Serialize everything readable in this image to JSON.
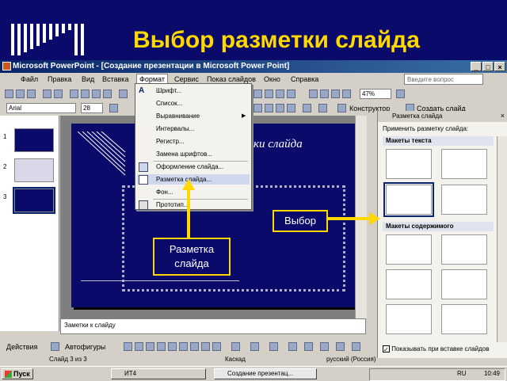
{
  "slide_title": "Выбор разметки слайда",
  "window": {
    "title": "Microsoft PowerPoint - [Создание презентации в Microsoft Power Point]"
  },
  "menubar": {
    "items": [
      "Файл",
      "Правка",
      "Вид",
      "Вставка",
      "Формат",
      "Сервис",
      "Показ слайдов",
      "Окно",
      "Справка"
    ],
    "ask_placeholder": "Введите вопрос"
  },
  "toolbar": {
    "zoom": "47%",
    "font": "Arial",
    "size": "28",
    "designer": "Конструктор",
    "new_slide": "Создать слайд"
  },
  "format_menu": {
    "items": [
      "Шрифт...",
      "Список...",
      "Выравнивание",
      "Интервалы...",
      "Регистр...",
      "Замена шрифтов...",
      "Оформление слайда...",
      "Разметка слайда...",
      "Фон...",
      "Прототип..."
    ]
  },
  "thumbs": [
    "1",
    "2",
    "3"
  ],
  "slide_title_partial": "ки слайда",
  "notes_placeholder": "Заметки к слайду",
  "taskpane": {
    "title": "Разметка слайда",
    "apply_label": "Применить разметку слайда:",
    "section_text": "Макеты текста",
    "section_content": "Макеты содержимого",
    "show_on_insert": "Показывать при вставке слайдов"
  },
  "drawbar": {
    "actions": "Действия",
    "autoshapes": "Автофигуры"
  },
  "statusbar": {
    "slide_of": "Слайд 3 из 3",
    "design": "Каскад",
    "lang": "русский (Россия)"
  },
  "taskbar": {
    "start": "Пуск",
    "task1": "ИТ4",
    "task2": "Создание презентац...",
    "clock": "10:49",
    "lang": "RU"
  },
  "callouts": {
    "select": "Выбор",
    "layout_line1": "Разметка",
    "layout_line2": "слайда"
  },
  "colors": {
    "slide_bg": "#0a0a6b",
    "accent": "#ffd800"
  }
}
